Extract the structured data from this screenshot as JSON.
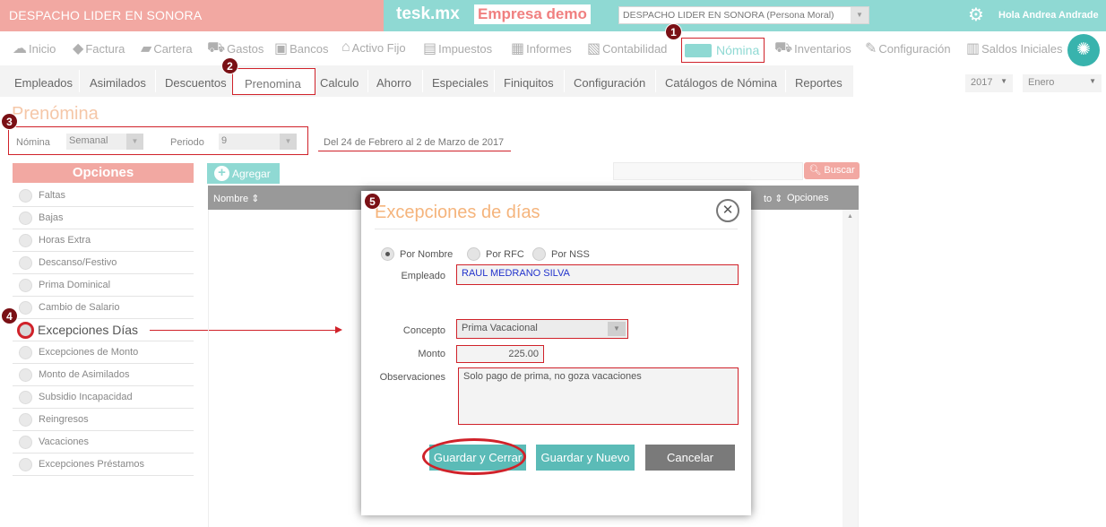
{
  "header": {
    "company_left": "DESPACHO LIDER EN SONORA",
    "brand": "tesk.mx",
    "demo": "Empresa demo",
    "company_select": "DESPACHO LIDER EN SONORA  (Persona Moral)",
    "greeting": "Hola Andrea Andrade",
    "accent_teal": "#8fd9d3",
    "accent_pink": "#f2a8a2"
  },
  "main_nav": [
    {
      "label": "Inicio",
      "icon": "cloud-icon"
    },
    {
      "label": "Factura",
      "icon": "tag-icon"
    },
    {
      "label": "Cartera",
      "icon": "wallet-icon"
    },
    {
      "label": "Gastos",
      "icon": "cart-icon"
    },
    {
      "label": "Bancos",
      "icon": "safe-icon"
    },
    {
      "label": "Activo Fijo",
      "icon": "home-icon"
    },
    {
      "label": "Impuestos",
      "icon": "briefcase-icon"
    },
    {
      "label": "Informes",
      "icon": "document-icon"
    },
    {
      "label": "Contabilidad",
      "icon": "calculator-icon"
    },
    {
      "label": "Nómina",
      "icon": "card-icon"
    },
    {
      "label": "Inventarios",
      "icon": "dolly-icon"
    },
    {
      "label": "Configuración",
      "icon": "wrench-icon"
    },
    {
      "label": "Saldos Iniciales",
      "icon": "stack-icon"
    }
  ],
  "sub_nav": [
    "Empleados",
    "Asimilados",
    "Descuentos",
    "Prenomina",
    "Calculo",
    "Ahorro",
    "Especiales",
    "Finiquitos",
    "Configuración",
    "Catálogos de Nómina",
    "Reportes"
  ],
  "year": "2017",
  "month": "Enero",
  "page_title": "Prenómina",
  "filters": {
    "nomina_label": "Nómina",
    "nomina_value": "Semanal",
    "periodo_label": "Periodo",
    "periodo_value": "9",
    "range": "Del 24 de Febrero al 2 de Marzo de 2017"
  },
  "options": {
    "header": "Opciones",
    "items": [
      "Faltas",
      "Bajas",
      "Horas Extra",
      "Descanso/Festivo",
      "Prima Dominical",
      "Cambio de Salario",
      "Excepciones Días",
      "Excepciones de Monto",
      "Monto de Asimilados",
      "Subsidio Incapacidad",
      "Reingresos",
      "Vacaciones",
      "Excepciones Préstamos"
    ],
    "selected": "Excepciones Días"
  },
  "table": {
    "add_label": "Agregar",
    "search_label": "Buscar",
    "columns": [
      "Nombre",
      "to",
      "Opciones"
    ]
  },
  "modal": {
    "title": "Excepciones de días",
    "radios": [
      "Por Nombre",
      "Por RFC",
      "Por NSS"
    ],
    "selected_radio": "Por Nombre",
    "empleado_label": "Empleado",
    "empleado_value": "RAUL MEDRANO SILVA",
    "concepto_label": "Concepto",
    "concepto_value": "Prima Vacacional",
    "monto_label": "Monto",
    "monto_value": "225.00",
    "observaciones_label": "Observaciones",
    "observaciones_value": "Solo pago de prima, no goza vacaciones",
    "btn_save_close": "Guardar y Cerrar",
    "btn_save_new": "Guardar y Nuevo",
    "btn_cancel": "Cancelar"
  },
  "steps": [
    "1",
    "2",
    "3",
    "4",
    "5"
  ]
}
